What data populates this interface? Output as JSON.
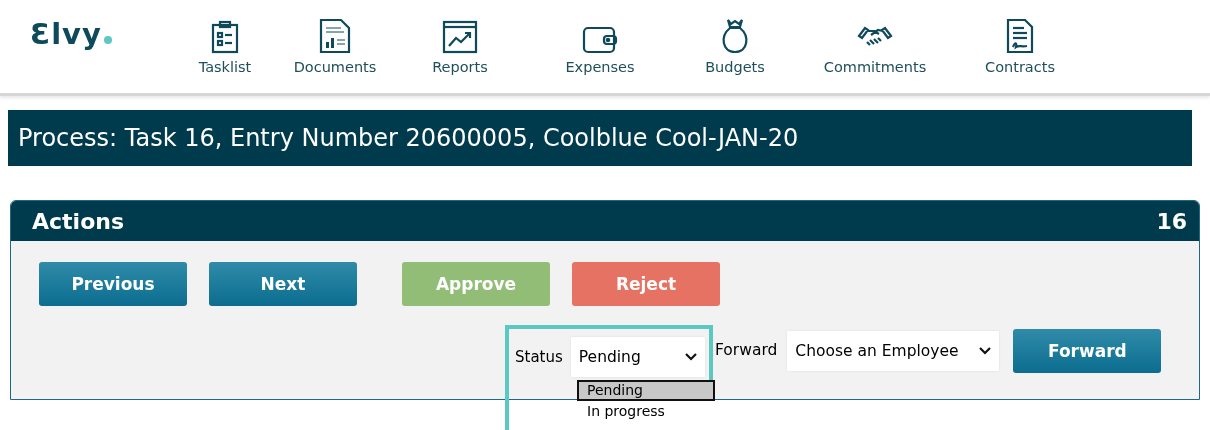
{
  "logo": "Ɛlvy",
  "nav": [
    {
      "label": "Tasklist"
    },
    {
      "label": "Documents"
    },
    {
      "label": "Reports"
    },
    {
      "label": "Expenses"
    },
    {
      "label": "Budgets"
    },
    {
      "label": "Commitments"
    },
    {
      "label": "Contracts"
    }
  ],
  "title": "Process: Task 16, Entry Number 20600005, Coolblue Cool-JAN-20",
  "panel": {
    "title": "Actions",
    "count": "16",
    "buttons": [
      {
        "label": "Previous",
        "kind": "nav"
      },
      {
        "label": "Next",
        "kind": "nav"
      },
      {
        "label": "Approve",
        "kind": "approve"
      },
      {
        "label": "Reject",
        "kind": "reject"
      }
    ],
    "status": {
      "label": "Status",
      "value": "Pending",
      "options": [
        {
          "label": "Pending",
          "selected": true
        },
        {
          "label": "In progress",
          "selected": false
        }
      ]
    },
    "forward": {
      "label": "Forward",
      "value": "Choose an Employee",
      "button": "Forward"
    }
  }
}
